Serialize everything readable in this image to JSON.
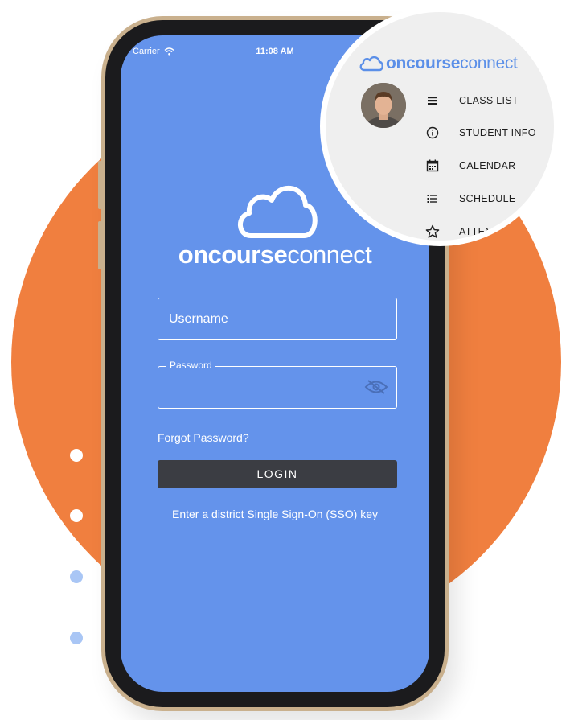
{
  "status_bar": {
    "carrier": "Carrier",
    "time": "11:08 AM"
  },
  "brand": {
    "bold": "oncourse",
    "light": "connect"
  },
  "login_form": {
    "username_placeholder": "Username",
    "password_label": "Password",
    "forgot_password": "Forgot Password?",
    "login_button": "LOGIN",
    "sso_link": "Enter a district Single Sign-On (SSO) key"
  },
  "menu_preview": {
    "logo_bold": "oncourse",
    "logo_light": "connect",
    "items": [
      {
        "label": "CLASS LIST",
        "icon": "list-icon"
      },
      {
        "label": "STUDENT INFO",
        "icon": "info-icon"
      },
      {
        "label": "CALENDAR",
        "icon": "calendar-icon"
      },
      {
        "label": "SCHEDULE",
        "icon": "schedule-icon"
      },
      {
        "label": "ATTENDA",
        "icon": "star-icon"
      }
    ]
  },
  "colors": {
    "screen_blue": "#6493eb",
    "accent_orange": "#f07f3f",
    "button_dark": "#3b3d43",
    "logo_blue": "#5b8fe8"
  }
}
